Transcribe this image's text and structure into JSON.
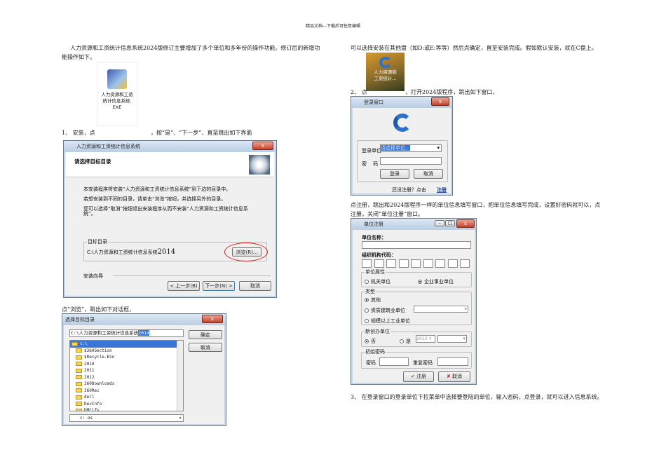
{
  "header": "精品文档---下载后可任意编辑",
  "left": {
    "intro_line1": "人力资源和工资统计信息系统2024版修订主要增加了多个单位和多年份的操作功能。修订后的新增功",
    "intro_line2": "能操作如下。",
    "exe_icon_label": [
      "人力资源和工资",
      "统计信息系统.",
      "EXE"
    ],
    "step1_a": "1、 安装，点",
    "step1_b": "，按“是”、“下一步”，直至跳出如下界面",
    "install_dialog": {
      "title": "人力资源和工资统计信息系统",
      "heading": "请选择目标目录",
      "line1": "本安装程序将安装“人力资源和工资统计信息系统”到下边的目录中。",
      "line2": "若想安装到不同的目录，请单击“浏览”按钮，并选择另外的目录。",
      "line3a": "您可以选择“取消”按钮退出安装程序从而不安装“人力资源和工资统计信息系",
      "line3b": "统”。",
      "group_label": "目标目录",
      "path": "C:\\人力资源和工资统计信息系统",
      "path_year": "2014",
      "browse": "浏览(R)...",
      "wizard_label": "安装向导",
      "back": "< 上一步(B)",
      "next": "下一步(N) >",
      "cancel": "取消",
      "close": "x"
    },
    "browse_caption": "点“浏览”，跳出如下对话框，",
    "browse_dialog": {
      "title": "选择目标目录",
      "path": "C:\\人力资源和工资统计信息系统",
      "path_sel": "2014",
      "ok": "确定",
      "cancel": "取消",
      "folders": [
        "c:\\",
        "$360Section",
        "$Recycle.Bin",
        "2010",
        "2011",
        "2012",
        "360Downloads",
        "360Rec",
        "dell",
        "DevInfo",
        "DMCifs"
      ],
      "drive": "c:  os",
      "close": "x"
    }
  },
  "right": {
    "para1": "可以选择安装在其他盘（如D:或E:等等）然后点确定，直至安装完成。假如默认安装，就在C盘上。",
    "desktop_icon_label": [
      "人力资源和",
      "工资统计..."
    ],
    "step2_a": "2、 点",
    "step2_b": "，打开2024版程序，跳出如下窗口，",
    "login": {
      "title": "登录窗口",
      "unit_label": "登录单位",
      "unit_value": "请选择单位...",
      "pwd_label": "密　 码",
      "login": "登录",
      "cancel": "取消",
      "hint": "还没注册？点击",
      "register": "注册",
      "close": "x"
    },
    "para2_line1": "点注册，跳出和2024版程序一样的单位信息填写窗口，把单位信息填写完成，设置好密码就可以，点",
    "para2_line2": "注册，关闭“单位注册”窗口。",
    "register": {
      "title": "单位注册",
      "name_label": "单位名称：",
      "org_label": "组织机构代码：",
      "attr_label": "单位属性",
      "attr_opt1": "机关单位",
      "attr_opt2": "企业事业单位",
      "type_label": "类型",
      "type_opt1": "其他",
      "type_opt2": "资质建筑业单位",
      "type_opt3": "规模以上工业单位",
      "new_label": "新创办单位",
      "new_no": "否",
      "new_yes": "是",
      "year": "2013",
      "pwd_group": "初始密码",
      "pwd": "密码",
      "pwd2": "重复密码",
      "ok": "注册",
      "cancel": "取消"
    },
    "step3": "3、 在登录窗口的登录单位下拉菜单中选择要登陆的单位，输入密码，点登录，就可以进入信息系统。"
  }
}
